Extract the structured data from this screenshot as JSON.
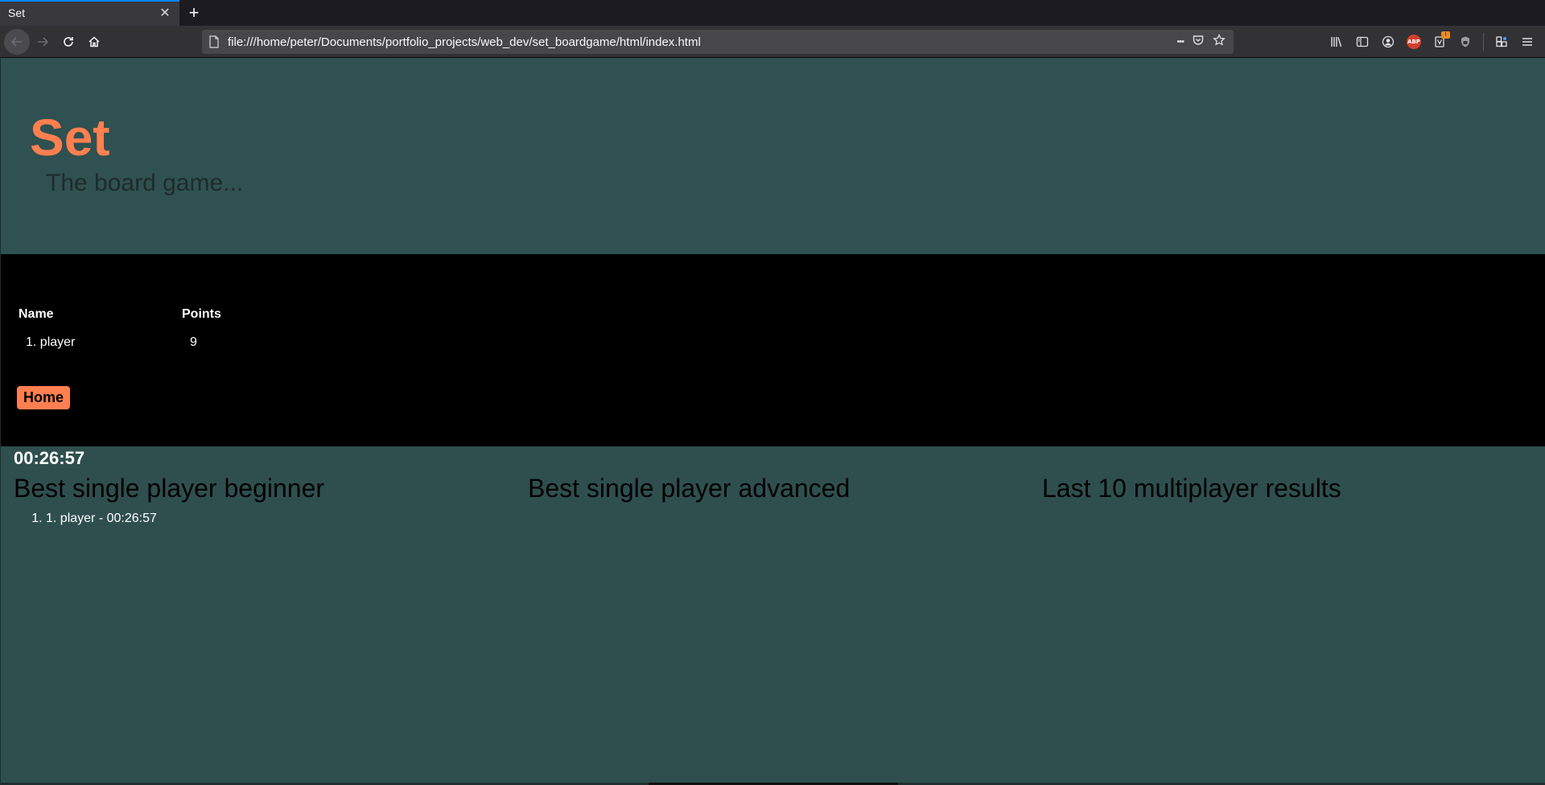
{
  "browser": {
    "tab_title": "Set",
    "tab_close": "✕",
    "new_tab": "+",
    "url": "file:///home/peter/Documents/portfolio_projects/web_dev/set_boardgame/html/index.html",
    "more": "•••",
    "abp_label": "ABP",
    "badge": "!"
  },
  "header": {
    "title": "Set",
    "subtitle": "The board game..."
  },
  "scoreboard": {
    "columns": [
      "Name",
      "Points"
    ],
    "rows": [
      {
        "name": "1. player",
        "points": "9"
      }
    ],
    "home_label": "Home"
  },
  "timer": "00:26:57",
  "results": {
    "beginner": {
      "heading": "Best single player beginner",
      "items": [
        "1. player - 00:26:57"
      ]
    },
    "advanced": {
      "heading": "Best single player advanced",
      "items": []
    },
    "multiplayer": {
      "heading": "Last 10 multiplayer results",
      "items": []
    }
  },
  "colors": {
    "accent": "#ff7f50",
    "background": "#2f4f4f",
    "scoreboard_bg": "#000000"
  }
}
